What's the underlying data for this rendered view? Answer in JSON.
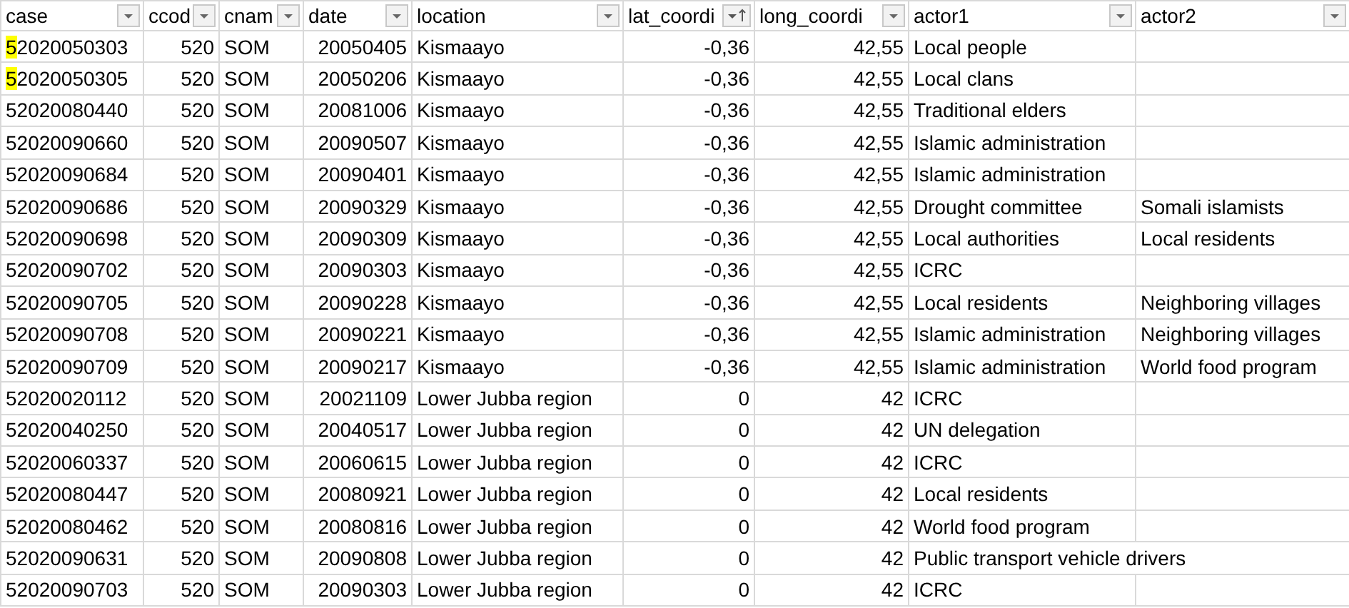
{
  "sheet": {
    "columns": [
      {
        "label": "case",
        "sorted": false
      },
      {
        "label": "ccod",
        "sorted": false
      },
      {
        "label": "cnam",
        "sorted": false
      },
      {
        "label": "date",
        "sorted": false
      },
      {
        "label": "location",
        "sorted": false
      },
      {
        "label": "lat_coordi",
        "sorted": true
      },
      {
        "label": "long_coordi",
        "sorted": false
      },
      {
        "label": "actor1",
        "sorted": false
      },
      {
        "label": "actor2",
        "sorted": false
      }
    ],
    "rows": [
      {
        "highlighted": true,
        "cells": [
          "52020050303",
          "520",
          "SOM",
          "20050405",
          "Kismaayo",
          "-0,36",
          "42,55",
          "Local people",
          ""
        ]
      },
      {
        "highlighted": true,
        "cells": [
          "52020050305",
          "520",
          "SOM",
          "20050206",
          "Kismaayo",
          "-0,36",
          "42,55",
          "Local clans",
          ""
        ]
      },
      {
        "highlighted": false,
        "cells": [
          "52020080440",
          "520",
          "SOM",
          "20081006",
          "Kismaayo",
          "-0,36",
          "42,55",
          "Traditional elders",
          ""
        ]
      },
      {
        "highlighted": false,
        "cells": [
          "52020090660",
          "520",
          "SOM",
          "20090507",
          "Kismaayo",
          "-0,36",
          "42,55",
          "Islamic administration",
          ""
        ]
      },
      {
        "highlighted": false,
        "cells": [
          "52020090684",
          "520",
          "SOM",
          "20090401",
          "Kismaayo",
          "-0,36",
          "42,55",
          "Islamic administration",
          ""
        ]
      },
      {
        "highlighted": false,
        "cells": [
          "52020090686",
          "520",
          "SOM",
          "20090329",
          "Kismaayo",
          "-0,36",
          "42,55",
          "Drought committee",
          "Somali islamists"
        ]
      },
      {
        "highlighted": false,
        "cells": [
          "52020090698",
          "520",
          "SOM",
          "20090309",
          "Kismaayo",
          "-0,36",
          "42,55",
          "Local authorities",
          "Local residents"
        ]
      },
      {
        "highlighted": false,
        "cells": [
          "52020090702",
          "520",
          "SOM",
          "20090303",
          "Kismaayo",
          "-0,36",
          "42,55",
          "ICRC",
          ""
        ]
      },
      {
        "highlighted": false,
        "cells": [
          "52020090705",
          "520",
          "SOM",
          "20090228",
          "Kismaayo",
          "-0,36",
          "42,55",
          "Local residents",
          "Neighboring villages"
        ]
      },
      {
        "highlighted": false,
        "cells": [
          "52020090708",
          "520",
          "SOM",
          "20090221",
          "Kismaayo",
          "-0,36",
          "42,55",
          "Islamic administration",
          "Neighboring villages"
        ]
      },
      {
        "highlighted": false,
        "cells": [
          "52020090709",
          "520",
          "SOM",
          "20090217",
          "Kismaayo",
          "-0,36",
          "42,55",
          "Islamic administration",
          "World food program"
        ]
      },
      {
        "highlighted": false,
        "cells": [
          "52020020112",
          "520",
          "SOM",
          "20021109",
          "Lower Jubba region",
          "0",
          "42",
          "ICRC",
          ""
        ]
      },
      {
        "highlighted": false,
        "cells": [
          "52020040250",
          "520",
          "SOM",
          "20040517",
          "Lower Jubba region",
          "0",
          "42",
          "UN delegation",
          ""
        ]
      },
      {
        "highlighted": false,
        "cells": [
          "52020060337",
          "520",
          "SOM",
          "20060615",
          "Lower Jubba region",
          "0",
          "42",
          "ICRC",
          ""
        ]
      },
      {
        "highlighted": false,
        "cells": [
          "52020080447",
          "520",
          "SOM",
          "20080921",
          "Lower Jubba region",
          "0",
          "42",
          "Local residents",
          ""
        ]
      },
      {
        "highlighted": false,
        "cells": [
          "52020080462",
          "520",
          "SOM",
          "20080816",
          "Lower Jubba region",
          "0",
          "42",
          "World food program",
          ""
        ]
      },
      {
        "highlighted": false,
        "cells": [
          "52020090631",
          "520",
          "SOM",
          "20090808",
          "Lower Jubba region",
          "0",
          "42",
          {
            "text": "Public transport vehicle drivers",
            "colspan": 2
          }
        ]
      },
      {
        "highlighted": false,
        "cells": [
          "52020090703",
          "520",
          "SOM",
          "20090303",
          "Lower Jubba region",
          "0",
          "42",
          "ICRC",
          ""
        ]
      }
    ]
  }
}
